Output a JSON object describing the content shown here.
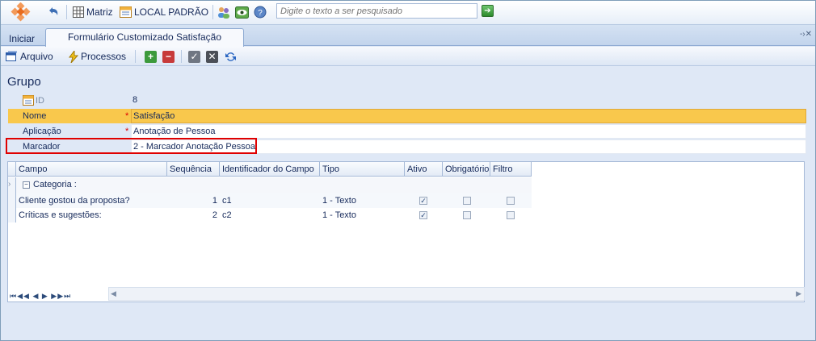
{
  "toolbar": {
    "back_icon": "back-arrow-icon",
    "matriz_label": "Matriz",
    "local_label": "LOCAL PADRÃO",
    "search_placeholder": "Digite o texto a ser pesquisado"
  },
  "tabs": {
    "home_label": "Iniciar",
    "active_label": "Formulário Customizado Satisfação"
  },
  "actions": {
    "arquivo_label": "Arquivo",
    "processos_label": "Processos"
  },
  "form": {
    "title": "Grupo",
    "id_label": "ID",
    "id_value": "8",
    "nome_label": "Nome",
    "nome_value": "Satisfação",
    "aplicacao_label": "Aplicação",
    "aplicacao_value": "Anotação de Pessoa",
    "marcador_label": "Marcador",
    "marcador_value": "2 - Marcador Anotação Pessoa",
    "required_mark": "*"
  },
  "grid": {
    "headers": [
      "Campo",
      "Sequência",
      "Identificador do Campo",
      "Tipo",
      "Ativo",
      "Obrigatório",
      "Filtro"
    ],
    "category_label": "Categoria :",
    "rows": [
      {
        "campo": "Cliente gostou da proposta?",
        "sequencia": "1",
        "identificador": "c1",
        "tipo": "1 - Texto",
        "ativo": true,
        "obrigatorio": false,
        "filtro": false
      },
      {
        "campo": "Críticas e sugestões:",
        "sequencia": "2",
        "identificador": "c2",
        "tipo": "1 - Texto",
        "ativo": true,
        "obrigatorio": false,
        "filtro": false
      }
    ]
  },
  "colors": {
    "selected_row": "#f9c84c",
    "highlight_border": "#e00000",
    "text": "#15295a"
  }
}
